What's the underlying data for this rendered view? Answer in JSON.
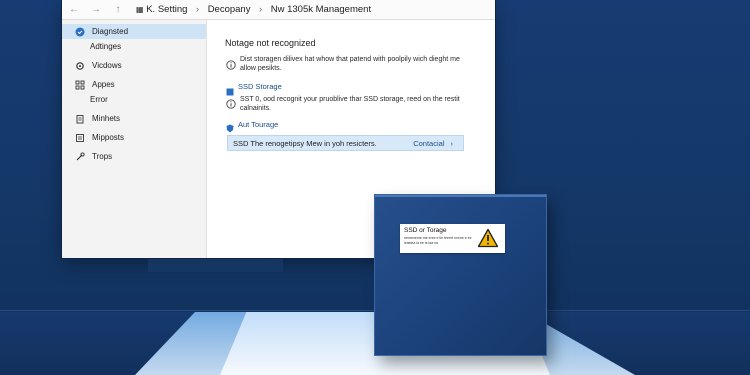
{
  "window": {
    "breadcrumb": [
      "K. Setting",
      "Decopany",
      "Nw  1305k Management"
    ]
  },
  "sidebar": {
    "items": [
      {
        "label": "Diagnsted",
        "icon": "shield-icon",
        "active": true
      },
      {
        "label": "Adtinges",
        "icon": "",
        "sub": true
      },
      {
        "label": "Vicdows",
        "icon": "gear-icon"
      },
      {
        "label": "Appes",
        "icon": "grid-icon"
      },
      {
        "label": "Error",
        "icon": "",
        "sub": true
      },
      {
        "label": "Minhets",
        "icon": "clipboard-icon"
      },
      {
        "label": "Mipposts",
        "icon": "list-icon"
      },
      {
        "label": "Trops",
        "icon": "wrench-icon"
      }
    ]
  },
  "main": {
    "heading": "Notage not recognized",
    "item1_text": "Dist storagen dilivex hat whow that patend with poolpily wich dieght me allow pesikts.",
    "ssd_title": "SSD Storage",
    "ssd_text": "SST 0, ood recognit your pruoblive thar SSD storage, reed on the restit calnainits.",
    "auto_title": "Aut Tourage",
    "notice_text": "SSD The renogetipsy Mew in yoh resicters.",
    "notice_action": "Contacial"
  },
  "device": {
    "label_title": "SSD or Torage",
    "label_fine": "nenrenenre nie eree e tie feeert nnnne e ee leaelea ia ee ie laa na"
  },
  "colors": {
    "background": "#173c73",
    "accent": "#1b4f8a",
    "warning": "#f2b500"
  }
}
